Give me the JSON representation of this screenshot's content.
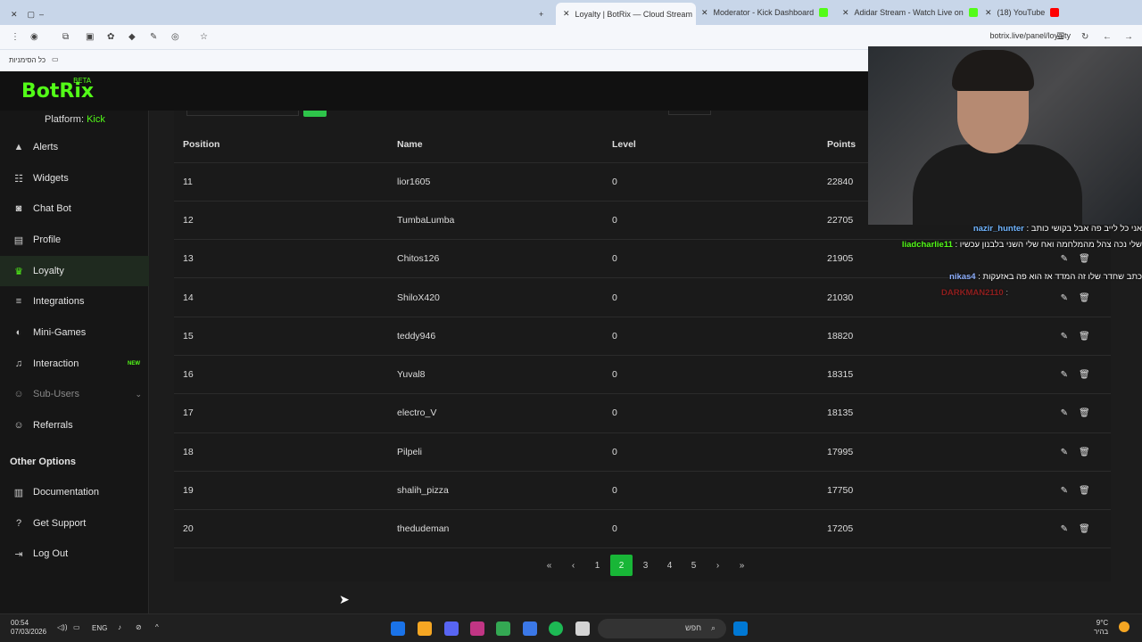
{
  "browser": {
    "tabs": [
      {
        "label": "Loyalty | BotRix — Cloud Stream",
        "active": true
      },
      {
        "label": "Moderator - Kick Dashboard"
      },
      {
        "label": "Adidar Stream - Watch Live on"
      },
      {
        "label": "(18) YouTube"
      }
    ],
    "url": "botrix.live/panel/loyalty",
    "bookmark_label": "כל הסימניות"
  },
  "app": {
    "logo": "BotRix",
    "logo_badge": "BETA",
    "platform_label": "Platform:",
    "platform_value": "Kick"
  },
  "sidebar": {
    "items": [
      {
        "label": "Alerts",
        "icon": "warning-icon"
      },
      {
        "label": "Widgets",
        "icon": "widgets-icon"
      },
      {
        "label": "Chat Bot",
        "icon": "robot-icon"
      },
      {
        "label": "Profile",
        "icon": "id-card-icon"
      },
      {
        "label": "Loyalty",
        "icon": "trophy-icon",
        "active": true
      },
      {
        "label": "Integrations",
        "icon": "list-icon"
      },
      {
        "label": "Mini-Games",
        "icon": "gamepad-icon"
      },
      {
        "label": "Interaction",
        "icon": "music-icon",
        "badge": "NEW"
      },
      {
        "label": "Sub-Users",
        "icon": "users-icon"
      },
      {
        "label": "Referrals",
        "icon": "users-icon"
      }
    ],
    "other_title": "Other Options",
    "other_items": [
      {
        "label": "Documentation",
        "icon": "book-icon"
      },
      {
        "label": "Get Support",
        "icon": "question-icon"
      },
      {
        "label": "Log Out",
        "icon": "logout-icon"
      }
    ]
  },
  "table": {
    "headers": [
      "Position",
      "Name",
      "Level",
      "Points"
    ],
    "rows": [
      {
        "position": "11",
        "name": "lior1605",
        "level": "0",
        "points": "22840"
      },
      {
        "position": "12",
        "name": "TumbaLumba",
        "level": "0",
        "points": "22705"
      },
      {
        "position": "13",
        "name": "Chitos126",
        "level": "0",
        "points": "21905"
      },
      {
        "position": "14",
        "name": "ShiloX420",
        "level": "0",
        "points": "21030"
      },
      {
        "position": "15",
        "name": "teddy946",
        "level": "0",
        "points": "18820"
      },
      {
        "position": "16",
        "name": "Yuval8",
        "level": "0",
        "points": "18315"
      },
      {
        "position": "17",
        "name": "electro_V",
        "level": "0",
        "points": "18135"
      },
      {
        "position": "18",
        "name": "Pilpeli",
        "level": "0",
        "points": "17995"
      },
      {
        "position": "19",
        "name": "shalih_pizza",
        "level": "0",
        "points": "17750"
      },
      {
        "position": "20",
        "name": "thedudeman",
        "level": "0",
        "points": "17205"
      }
    ]
  },
  "pagination": {
    "first": "«",
    "prev": "‹",
    "pages": [
      "1",
      "2",
      "3",
      "4",
      "5"
    ],
    "current": "2",
    "next": "›",
    "last": "»"
  },
  "chat": [
    {
      "user": "nazir_hunter",
      "text": "אני כל לייב פה אבל בקושי כותב"
    },
    {
      "user": "liadcharlie11",
      "text": "שלי נכה צהל מהמלחמה ואח שלי השני בלבנון עכשיו"
    },
    {
      "user": "nikas4",
      "text": "כתב שחדר שלו זה המדד אז הוא פה באזעקות"
    },
    {
      "user": "DARKMAN2110",
      "text": ""
    }
  ],
  "taskbar": {
    "time": "00:54",
    "date": "07/03/2026",
    "lang": "ENG",
    "search_placeholder": "חפש",
    "weather": "9°C",
    "weather_sub": "בהיר"
  }
}
